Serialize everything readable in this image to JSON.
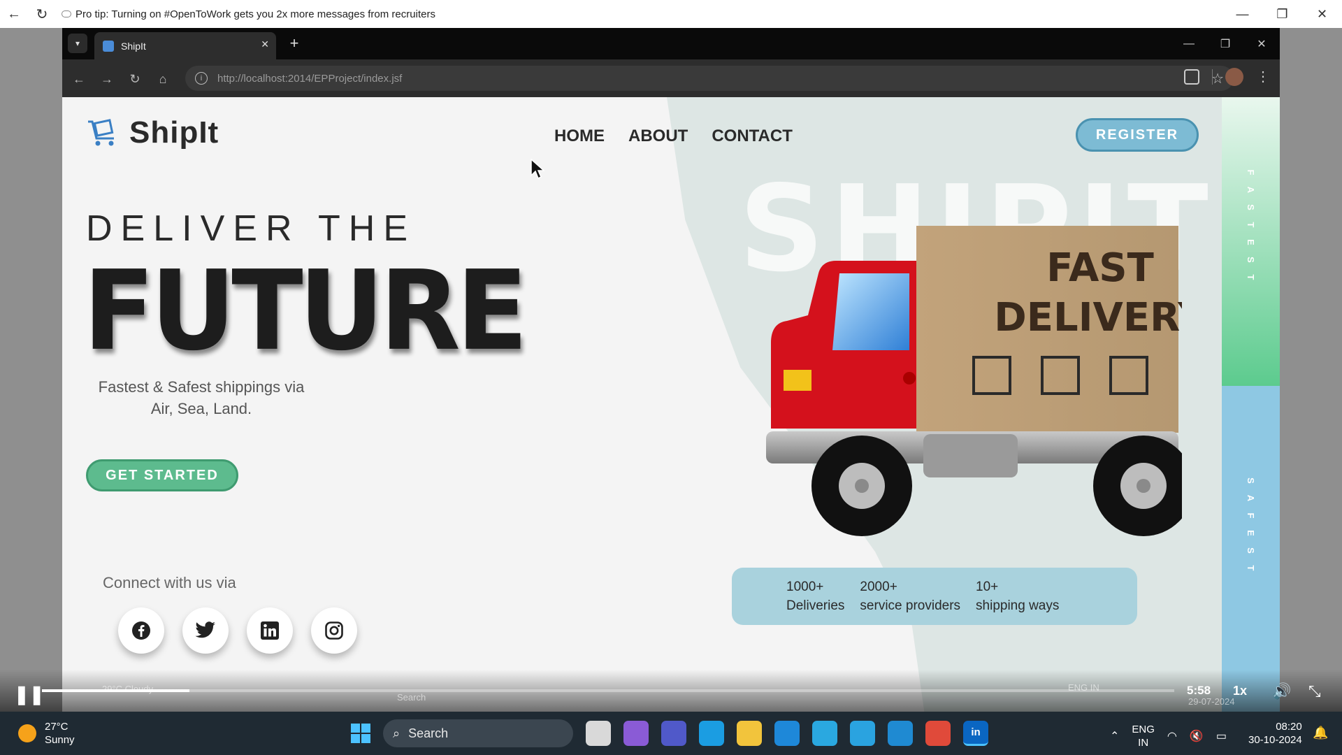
{
  "viewer": {
    "tip": "Pro tip: Turning on #OpenToWork gets you 2x more messages from recruiters"
  },
  "browser": {
    "tab_title": "ShipIt",
    "url": "http://localhost:2014/EPProject/index.jsf"
  },
  "site": {
    "brand": "ShipIt",
    "nav": [
      "HOME",
      "ABOUT",
      "CONTACT"
    ],
    "register_label": "REGISTER",
    "headline_top": "DELIVER THE",
    "headline_main": "FUTURE",
    "subtitle": "Fastest & Safest shippings via Air, Sea, Land.",
    "cta_label": "GET STARTED",
    "connect_label": "Connect with us via",
    "socials": [
      "facebook-icon",
      "twitter-icon",
      "linkedin-icon",
      "instagram-icon"
    ],
    "bg_word": "SHIPIT",
    "rail_top": "FASTEST",
    "rail_bottom": "SAFEST",
    "truck_box_line1": "FAST",
    "truck_box_line2": "DELIVERY",
    "stats": [
      {
        "value": "1000+",
        "label": "Deliveries"
      },
      {
        "value": "2000+",
        "label": "service providers"
      },
      {
        "value": "10+",
        "label": "shipping ways"
      }
    ]
  },
  "video": {
    "time": "5:58",
    "speed": "1x",
    "progress": 0.13,
    "ghost_weather": "29°C Cloudy",
    "ghost_search": "Search",
    "ghost_lang": "ENG IN",
    "ghost_date": "29-07-2024"
  },
  "taskbar": {
    "temperature": "27°C",
    "condition": "Sunny",
    "search_label": "Search",
    "lang_line1": "ENG",
    "lang_line2": "IN",
    "time": "08:20",
    "date": "30-10-2024"
  },
  "colors": {
    "register": "#7dbbd4",
    "cta": "#5dbb8e",
    "stats_bg": "#a9d2dd",
    "rail_green": "#5ccb8e",
    "rail_blue": "#8ec8e3"
  }
}
